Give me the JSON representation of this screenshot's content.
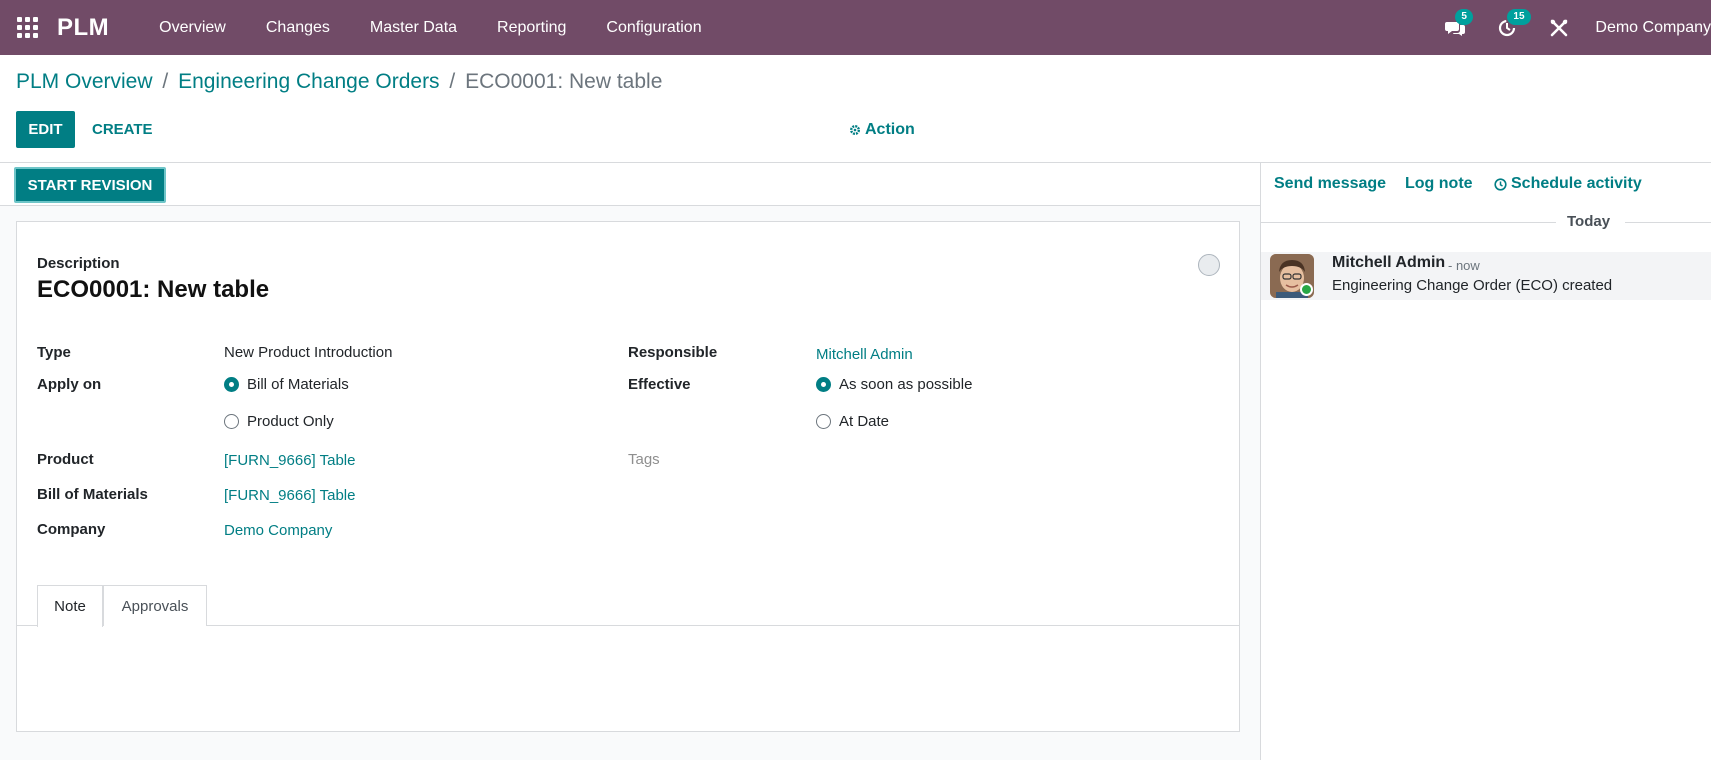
{
  "navbar": {
    "brand": "PLM",
    "menu": [
      "Overview",
      "Changes",
      "Master Data",
      "Reporting",
      "Configuration"
    ],
    "messages_count": "5",
    "activities_count": "15",
    "company": "Demo Company",
    "background_color": "#714b67"
  },
  "breadcrumb": {
    "item1": "PLM Overview",
    "item2": "Engineering Change Orders",
    "separator": "/",
    "current": "ECO0001: New table"
  },
  "control": {
    "edit_label": "EDIT",
    "create_label": "CREATE",
    "action_label": "Action"
  },
  "statusbar": {
    "start_revision_label": "START REVISION"
  },
  "form": {
    "description_label": "Description",
    "title": "ECO0001: New table",
    "type_label": "Type",
    "type_value": "New Product Introduction",
    "apply_on_label": "Apply on",
    "apply_on_options": [
      "Bill of Materials",
      "Product Only"
    ],
    "apply_on_selected": "Bill of Materials",
    "product_label": "Product",
    "product_value": "[FURN_9666] Table",
    "bom_label": "Bill of Materials",
    "bom_value": "[FURN_9666] Table",
    "company_label": "Company",
    "company_value": "Demo Company",
    "responsible_label": "Responsible",
    "responsible_value": "Mitchell Admin",
    "effective_label": "Effective",
    "effective_options": [
      "As soon as possible",
      "At Date"
    ],
    "effective_selected": "As soon as possible",
    "tags_placeholder": "Tags",
    "tabs": [
      "Note",
      "Approvals"
    ],
    "active_tab": "Note"
  },
  "chatter": {
    "send_message": "Send message",
    "log_note": "Log note",
    "schedule_activity": "Schedule activity",
    "date_separator": "Today",
    "message": {
      "author": "Mitchell Admin",
      "time": "- now",
      "body": "Engineering Change Order (ECO) created"
    }
  },
  "colors": {
    "primary": "#017e84",
    "brand": "#714b67",
    "badge": "#00a09d"
  }
}
